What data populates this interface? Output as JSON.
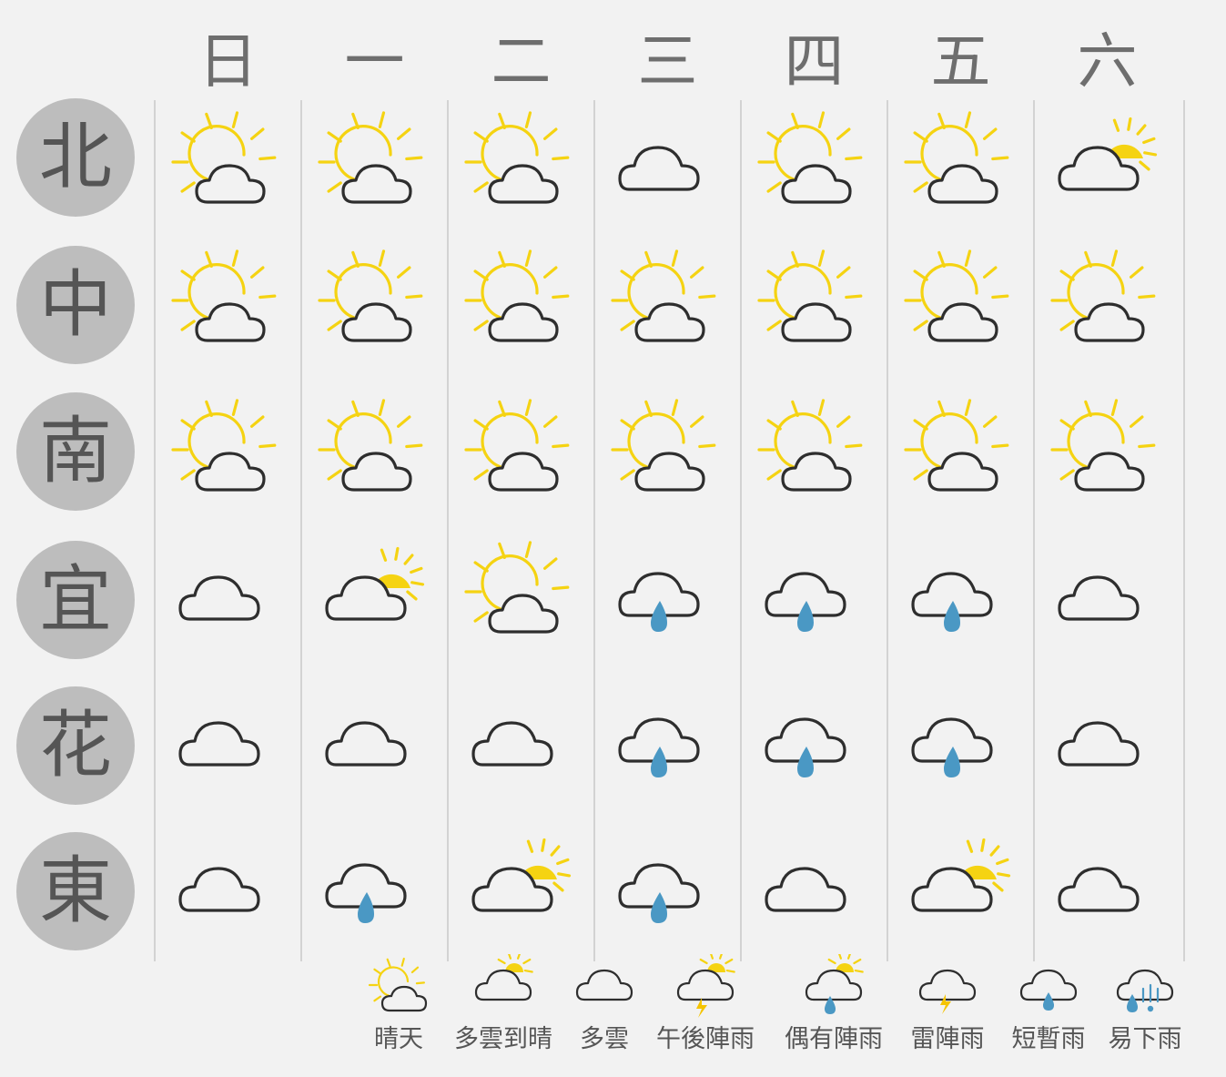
{
  "days": [
    "日",
    "一",
    "二",
    "三",
    "四",
    "五",
    "六"
  ],
  "regions": [
    "北",
    "中",
    "南",
    "宜",
    "花",
    "東"
  ],
  "forecast": [
    [
      "sunny",
      "sunny",
      "sunny",
      "cloudy",
      "sunny",
      "sunny",
      "cloudy-clearing"
    ],
    [
      "sunny",
      "sunny",
      "sunny",
      "sunny",
      "sunny",
      "sunny",
      "sunny"
    ],
    [
      "sunny",
      "sunny",
      "sunny",
      "sunny",
      "sunny",
      "sunny",
      "sunny"
    ],
    [
      "cloudy",
      "cloudy-clearing",
      "sunny",
      "brief-rain",
      "brief-rain",
      "brief-rain",
      "cloudy"
    ],
    [
      "cloudy",
      "cloudy",
      "cloudy",
      "brief-rain",
      "brief-rain",
      "brief-rain",
      "cloudy"
    ],
    [
      "cloudy",
      "brief-rain",
      "cloudy-clearing",
      "brief-rain",
      "cloudy",
      "cloudy-clearing",
      "cloudy"
    ]
  ],
  "legend": [
    {
      "key": "sunny",
      "label": "晴天"
    },
    {
      "key": "cloudy-clearing",
      "label": "多雲到晴"
    },
    {
      "key": "cloudy",
      "label": "多雲"
    },
    {
      "key": "afternoon-thunder",
      "label": "午後陣雨"
    },
    {
      "key": "occasional-showers",
      "label": "偶有陣雨"
    },
    {
      "key": "thunderstorm",
      "label": "雷陣雨"
    },
    {
      "key": "brief-rain",
      "label": "短暫雨"
    },
    {
      "key": "likely-rain",
      "label": "易下雨"
    }
  ],
  "colors": {
    "sun": "#f5d312",
    "cloud_outline": "#2e2e2e",
    "rain": "#4a98c4",
    "badge": "#bdbdbd",
    "text": "#6e6e6e"
  }
}
